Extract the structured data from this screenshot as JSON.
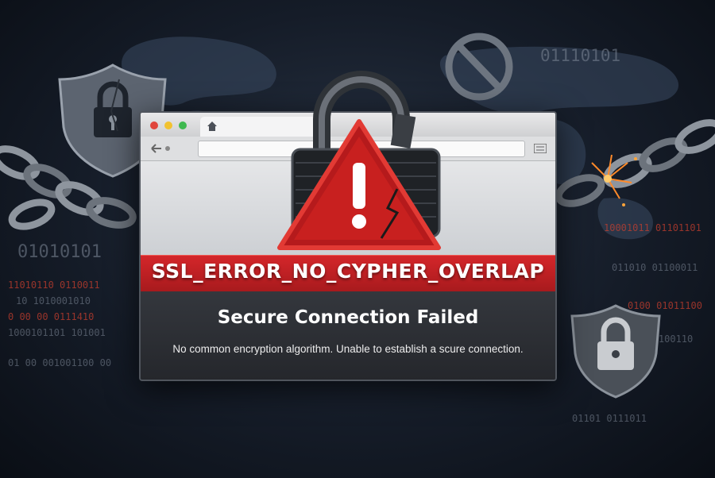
{
  "background": {
    "binary_left_big": "01010101",
    "binary_top_right": "01110101",
    "binary_rows_left": [
      "11010110 0110011",
      "10 1010001010",
      "0 00 00 0111410",
      "1000101101 101001",
      "01 00 001001100 00"
    ],
    "binary_rows_right": [
      "10001011 01101101",
      "011010 01100011",
      "0100 01011100",
      "00 0100110",
      "01101 0111011"
    ]
  },
  "browser": {
    "title_dots": [
      "#e0463d",
      "#f2c230",
      "#3fb950"
    ],
    "home_icon": "home-icon",
    "back_icon": "back-arrow-icon",
    "menu_icon": "menu-icon"
  },
  "error": {
    "code": "SSL_ERROR_NO_CYPHER_OVERLAP",
    "headline": "Secure Connection Failed",
    "description": "No common encryption algorithm. Unable to establish a scure connection."
  },
  "icons": {
    "warning": "warning-triangle-icon",
    "padlock": "broken-padlock-icon",
    "shield_left": "shield-lock-icon",
    "shield_right": "shield-lock-icon",
    "prohibited": "prohibited-icon",
    "chains": "broken-chain-icon"
  },
  "colors": {
    "accent_red": "#c8201f",
    "dark_bg": "#151c28"
  }
}
